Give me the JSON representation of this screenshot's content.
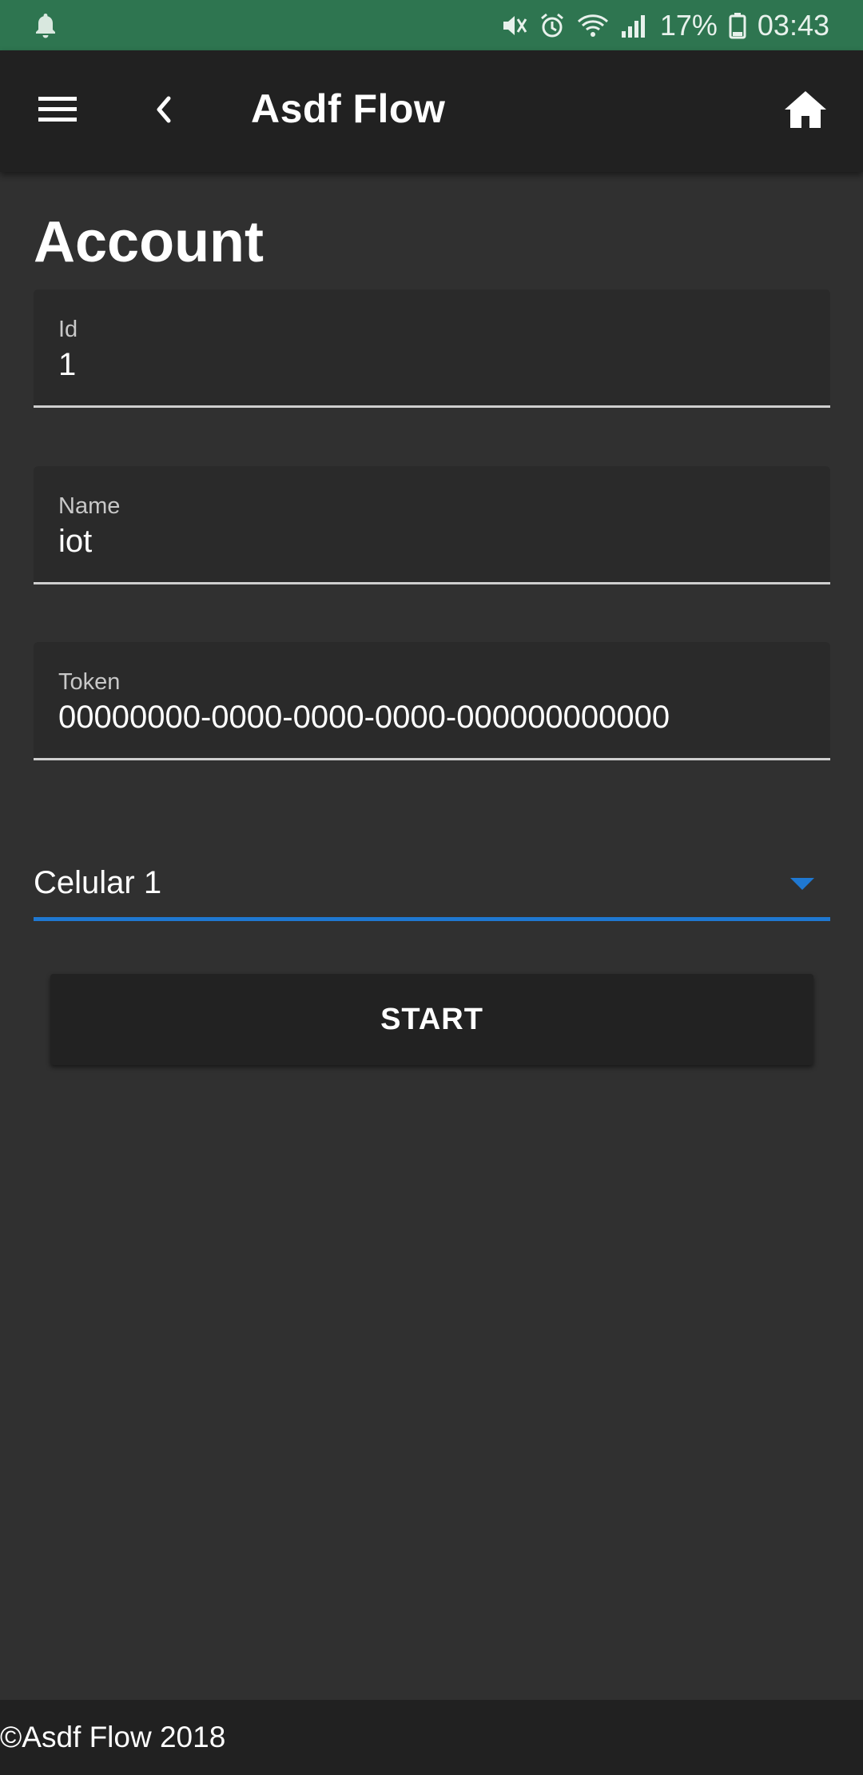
{
  "status_bar": {
    "battery": "17%",
    "time": "03:43",
    "icons": [
      "notification-bell-icon",
      "mute-icon",
      "alarm-icon",
      "wifi-icon",
      "signal-icon",
      "battery-icon"
    ]
  },
  "app_bar": {
    "title": "Asdf Flow",
    "icons": [
      "menu-icon",
      "back-chevron-icon",
      "home-icon"
    ]
  },
  "page": {
    "title": "Account"
  },
  "form": {
    "id": {
      "label": "Id",
      "value": "1"
    },
    "name": {
      "label": "Name",
      "value": "iot"
    },
    "token": {
      "label": "Token",
      "value": "00000000-0000-0000-0000-000000000000"
    },
    "device_select": {
      "selected": "Celular 1"
    }
  },
  "actions": {
    "start_label": "START"
  },
  "footer": {
    "text": "©Asdf Flow 2018"
  },
  "colors": {
    "status_bar": "#2e7550",
    "app_bar": "#212121",
    "background": "#303030",
    "accent": "#1f78d1"
  }
}
